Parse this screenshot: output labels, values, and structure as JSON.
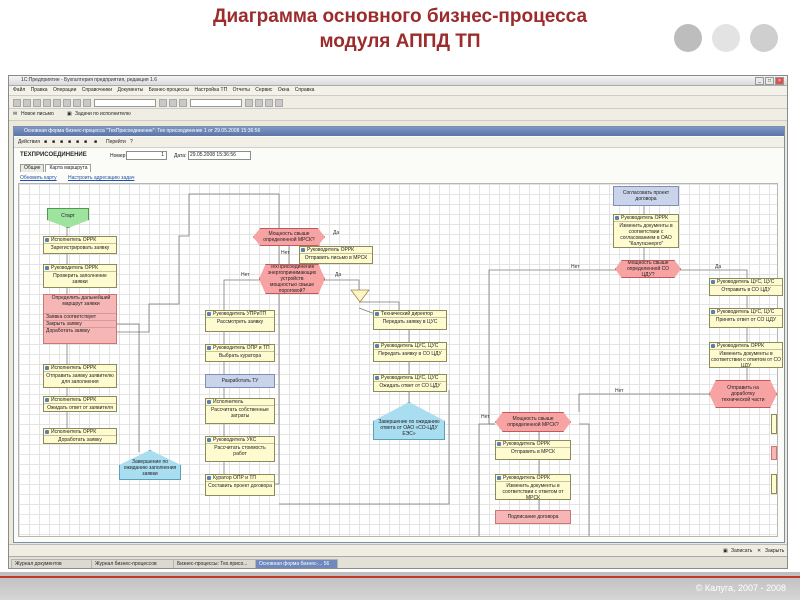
{
  "slide": {
    "title_line1": "Диаграмма основного бизнес-процесса",
    "title_line2": "модуля АППД ТП",
    "footer": "© Калуга, 2007 - 2008"
  },
  "app": {
    "window_title": "1С:Предприятие - Бухгалтерия предприятия, редакция 1.6",
    "menu": [
      "Файл",
      "Правка",
      "Операции",
      "Справочники",
      "Документы",
      "Бизнес-процессы",
      "Настройка ТП",
      "Отчеты",
      "Сервис",
      "Окна",
      "Справка"
    ],
    "toolbar2": {
      "new_letter": "Новое письмо",
      "tasks": "Задачи по исполнителю"
    }
  },
  "doc": {
    "window_title": "Основная форма бизнес-процесса \"ТехПрисоединение\": Тех присоединение 1 от 29.05.2008 15:36:56",
    "actions": "Действия",
    "goto": "Перейти",
    "form_title": "ТЕХПРИСОЕДИНЕНИЕ",
    "number_label": "Номер:",
    "number_value": "1",
    "date_label": "Дата:",
    "date_value": "29.05.2008 15:36:56",
    "tabs": [
      "Общие",
      "Карта маршрута"
    ],
    "link_refresh": "Обновить карту",
    "link_settings": "Настроить адресацию задач"
  },
  "flow": {
    "start": "Старт",
    "n1": {
      "role": "Исполнитель ОРРК",
      "text": "Зарегистрировать заявку"
    },
    "n2": {
      "role": "Руководитель ОРРК",
      "text": "Проверить заполнение заявки"
    },
    "pink": {
      "head": "Определить дальнейший маршрут заявки",
      "rows": [
        "Заявка соответствует",
        "Закрыть заявку",
        "Доработать заявку"
      ]
    },
    "n3": {
      "role": "Исполнитель ОРРК",
      "text": "Отправить заявку заявителю для заполнения"
    },
    "n4": {
      "role": "Исполнитель ОРРК",
      "text": "Ожидать ответ от заявителя"
    },
    "n5": {
      "role": "Исполнитель ОРРК",
      "text": "Доработать заявку"
    },
    "end1": "Завершение по ожиданию заполнения заявки",
    "c1": "Мощность свыше определенной МРСК?",
    "c1_yes": "Да",
    "c1_no": "Нет",
    "n6": {
      "role": "Руководитель ОРРК",
      "text": "Отправить письмо в МРСК"
    },
    "c2": "ТехПрисоединение энергопринимающих устройств мощностью свыше пороговой?",
    "c2_no": "Нет",
    "c2_yes": "Да",
    "n7": {
      "role": "Руководитель УПРиТП",
      "text": "Рассмотреть заявку"
    },
    "n8": {
      "role": "Руководитель ОПР и ТП",
      "text": "Выбрать куратора"
    },
    "n9": "Разработать ТУ",
    "n10": {
      "role": "Исполнитель",
      "text": "Рассчитать собственные затраты"
    },
    "n11": {
      "role": "Руководитель УКС",
      "text": "Рассчитать стоимость работ"
    },
    "n12": {
      "role": "Куратор ОПР и ТП",
      "text": "Составить проект договора"
    },
    "n13": {
      "role": "Технический директор",
      "text": "Передать заявку в ЦУС"
    },
    "n14": {
      "role": "Руководитель ЦУС, ЦУС",
      "text": "Передать заявку в СО ЦДУ"
    },
    "n15": {
      "role": "Руководитель ЦУС, ЦУС",
      "text": "Ожидать ответ от СО ЦДУ"
    },
    "end2": "Завершение по ожиданию ответа от ОАО «СО-ЦДУ ЕЭС»",
    "n16": "Согласовать проект договора",
    "n17": {
      "role": "Руководитель ОРРК",
      "text": "Изменить документы в соответствии с согласованием в ОАО \"Калугаэнерго\""
    },
    "c3": "Мощность свыше определенной СО ЦДУ?",
    "c3_no": "Нет",
    "c3_yes": "Да",
    "n18": {
      "role": "Руководитель ЦУС, ЦУС",
      "text": "Отправить в СО ЦДУ"
    },
    "n19": {
      "role": "Руководитель ЦУС, ЦУС",
      "text": "Принять ответ от СО ЦДУ"
    },
    "n20": {
      "role": "Руководитель ОРРК",
      "text": "Изменить документы в соответствии с ответом от СО ЦДУ"
    },
    "n21": "Отправить на доработку технической части",
    "c4": "Мощность свыше определенной МРСК?",
    "c4_no": "Нет",
    "c4_yes": "Нет",
    "n22": {
      "role": "Руководитель ОРРК",
      "text": "Отправить в МРСК"
    },
    "n23": {
      "role": "Руководитель ОРРК",
      "text": "Изменить документы в соответствии с ответом от МРСК"
    },
    "n24": "Подписание договора"
  },
  "status": {
    "save": "Записать",
    "close": "Закрыть"
  },
  "taskbar": [
    "Журнал документов",
    "Журнал бизнес-процессов",
    "Бизнес-процессы: Тех.присо...",
    "Основная форма бизнес-... 56"
  ]
}
